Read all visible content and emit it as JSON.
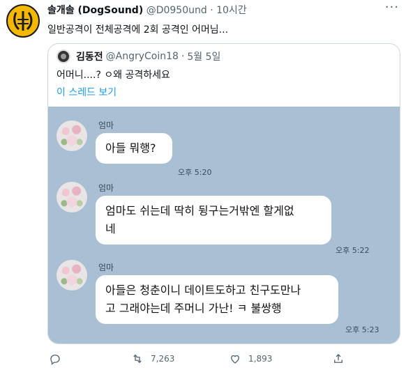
{
  "tweet": {
    "display_name": "솔개솔 (DogSound)",
    "handle": "@D0950und",
    "separator": "·",
    "time": "10시간",
    "text": "일반공격이 전체공격에 2회 공격인 어머님..."
  },
  "quote": {
    "display_name": "김동전",
    "handle": "@AngryCoin18",
    "separator": "·",
    "date": "5월 5일",
    "text": "어머니....? ㅇ왜 공격하세요",
    "thread_link": "이 스레드 보기"
  },
  "chat": {
    "messages": [
      {
        "sender": "엄마",
        "lines": [
          "아들 뭐행?"
        ],
        "time": "오후 5:20"
      },
      {
        "sender": "엄마",
        "lines": [
          "엄마도 쉬는데 딱히 뒹구는거밖엔 할게없",
          "네"
        ],
        "time": "오후 5:22"
      },
      {
        "sender": "엄마",
        "lines": [
          "아들은 청춘이니 데이트도하고 친구도만나",
          "고 그래야는데 주머니 가난! ㅋ 불쌍행"
        ],
        "time": "오후 5:23"
      }
    ]
  },
  "actions": {
    "retweet_count": "7,263",
    "like_count": "1,893"
  },
  "colors": {
    "chat_background": "#a9bfd3",
    "link_blue": "#1d9bf0",
    "secondary_text": "#536471"
  },
  "icons": [
    "more-icon",
    "reply-icon",
    "retweet-icon",
    "like-icon",
    "share-icon"
  ]
}
